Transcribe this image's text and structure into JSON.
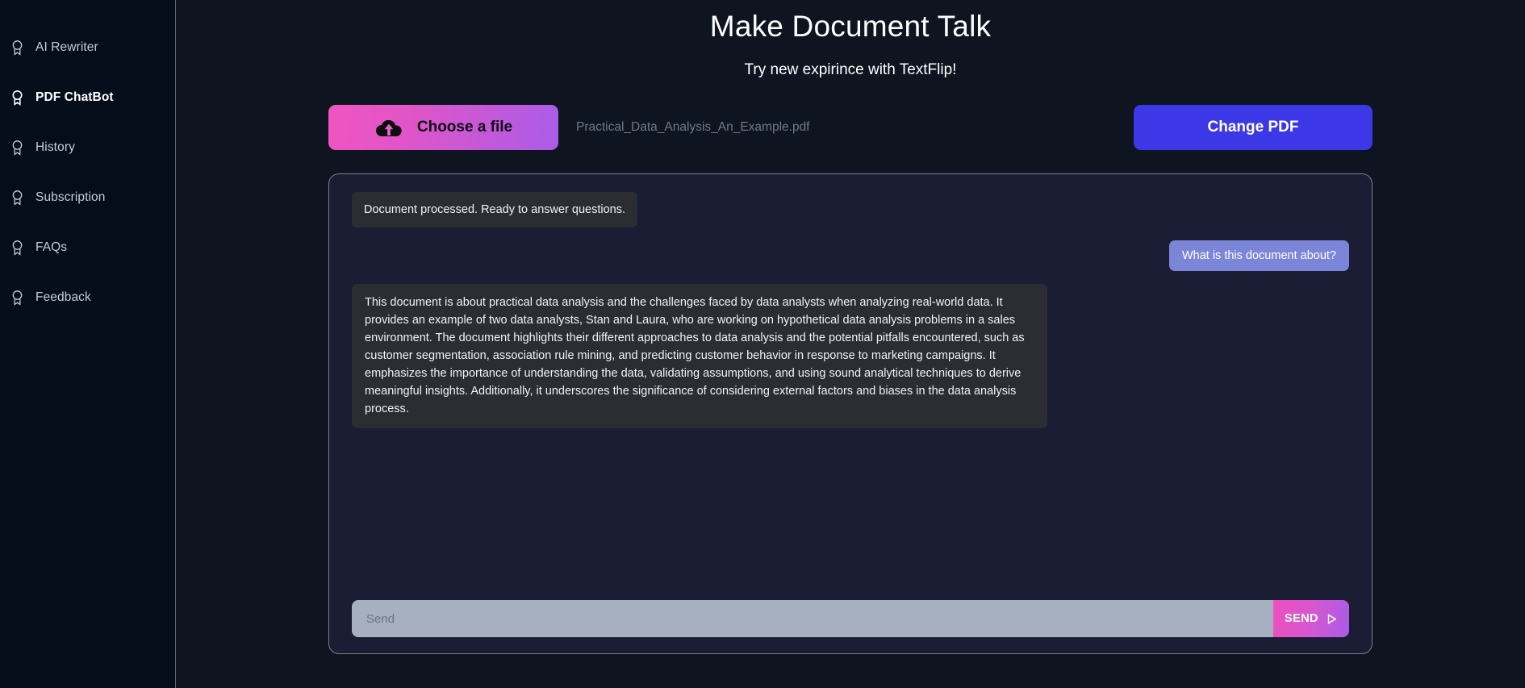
{
  "sidebar": {
    "items": [
      {
        "label": "AI Rewriter",
        "icon": "award-badge-icon",
        "active": false
      },
      {
        "label": "PDF ChatBot",
        "icon": "award-badge-icon",
        "active": true
      },
      {
        "label": "History",
        "icon": "award-badge-icon",
        "active": false
      },
      {
        "label": "Subscription",
        "icon": "award-badge-icon",
        "active": false
      },
      {
        "label": "FAQs",
        "icon": "award-badge-icon",
        "active": false
      },
      {
        "label": "Feedback",
        "icon": "award-badge-icon",
        "active": false
      }
    ]
  },
  "header": {
    "title": "Make Document Talk",
    "subtitle": "Try new expirince with TextFlip!"
  },
  "upload": {
    "choose_file_label": "Choose a file",
    "choose_file_icon": "cloud-upload-icon",
    "file_name": "Practical_Data_Analysis_An_Example.pdf",
    "change_pdf_label": "Change PDF"
  },
  "chat": {
    "messages": [
      {
        "role": "bot",
        "text": "Document processed. Ready to answer questions."
      },
      {
        "role": "user",
        "text": "What is this document about?"
      },
      {
        "role": "bot",
        "text": "This document is about practical data analysis and the challenges faced by data analysts when analyzing real-world data. It provides an example of two data analysts, Stan and Laura, who are working on hypothetical data analysis problems in a sales environment. The document highlights their different approaches to data analysis and the potential pitfalls encountered, such as customer segmentation, association rule mining, and predicting customer behavior in response to marketing campaigns. It emphasizes the importance of understanding the data, validating assumptions, and using sound analytical techniques to derive meaningful insights. Additionally, it underscores the significance of considering external factors and biases in the data analysis process."
      }
    ],
    "input_placeholder": "Send",
    "input_value": "",
    "send_label": "SEND",
    "send_icon": "send-play-icon"
  },
  "colors": {
    "page_background": "#0e1420",
    "sidebar_background": "#050d1a",
    "chat_panel_background": "#1a1d33",
    "chat_panel_border": "#79808f",
    "bot_bubble": "#2b2d33",
    "user_bubble": "#7b86d8",
    "accent_gradient_start": "#ee4fbe",
    "accent_gradient_end": "#a95ce8",
    "change_pdf_button": "#3c38e8",
    "input_background": "#a6b0c0"
  }
}
